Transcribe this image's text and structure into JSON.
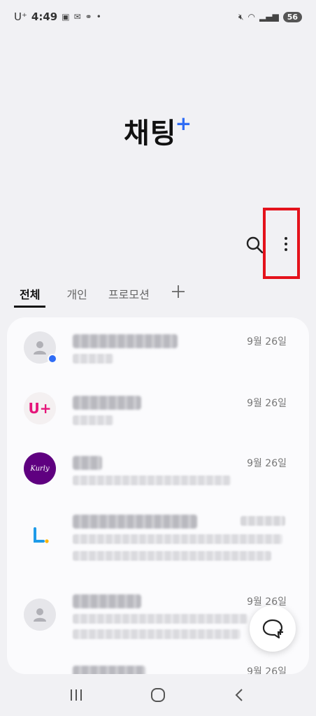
{
  "status_bar": {
    "carrier": "U⁺",
    "time": "4:49",
    "battery": "56"
  },
  "header": {
    "title": "채팅",
    "title_plus": "+"
  },
  "tabs": [
    {
      "label": "전체",
      "active": true
    },
    {
      "label": "개인",
      "active": false
    },
    {
      "label": "프로모션",
      "active": false
    }
  ],
  "chats": [
    {
      "avatar": "person-icon",
      "unread": true,
      "date": "9월 26일"
    },
    {
      "avatar": "uplus-logo",
      "avatar_text": "U+",
      "date": "9월 26일"
    },
    {
      "avatar": "kurly-logo",
      "avatar_text": "Kurly",
      "date": "9월 26일"
    },
    {
      "avatar": "lpoint-logo",
      "date": ""
    },
    {
      "avatar": "person-icon",
      "date": "9월 26일"
    },
    {
      "avatar": "person-icon",
      "date": "9월 26일"
    }
  ],
  "colors": {
    "accent": "#2f6cf5",
    "highlight": "#e4121b",
    "background": "#f1f1f4"
  }
}
